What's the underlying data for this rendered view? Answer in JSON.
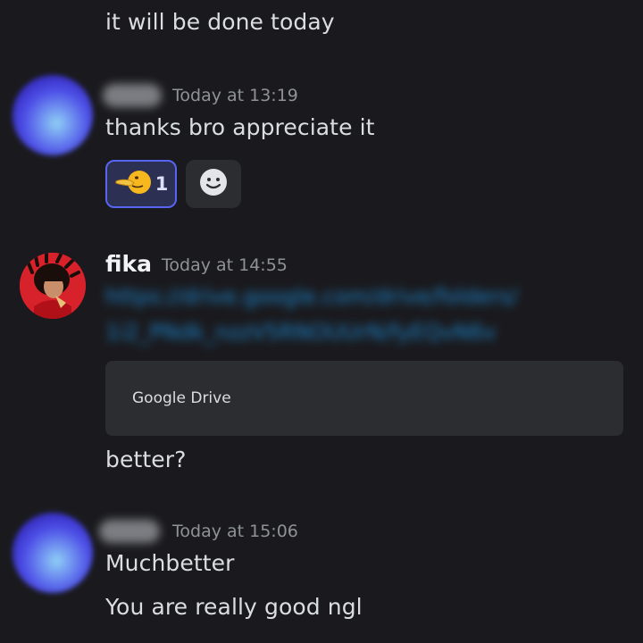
{
  "messages": [
    {
      "text": "it will be done today"
    },
    {
      "timestamp": "Today at 13:19",
      "text": "thanks bro appreciate it",
      "reactions": [
        {
          "emoji": "shushing-face-emoji",
          "count": "1"
        },
        {
          "emoji": "add-reaction-icon"
        }
      ]
    },
    {
      "username": "fika",
      "timestamp": "Today at 14:55",
      "link_lines": [
        "https://drive.google.com/drive/folders/",
        "1i2_PNdk_nzzV5RNOUUrN/fyEQvN6v"
      ],
      "embed": {
        "provider": "Google Drive"
      },
      "text": "better?"
    },
    {
      "timestamp": "Today at 15:06",
      "lines": [
        "Muchbetter",
        "You are really good ngl"
      ]
    }
  ],
  "colors": {
    "background": "#1a1a1e",
    "text": "#dbdee1",
    "timestamp": "#8e9297",
    "link": "#1d8fdc",
    "reaction_active_bg": "#2c3053",
    "reaction_active_border": "#5865f2",
    "embed_bg": "#2b2d31"
  }
}
